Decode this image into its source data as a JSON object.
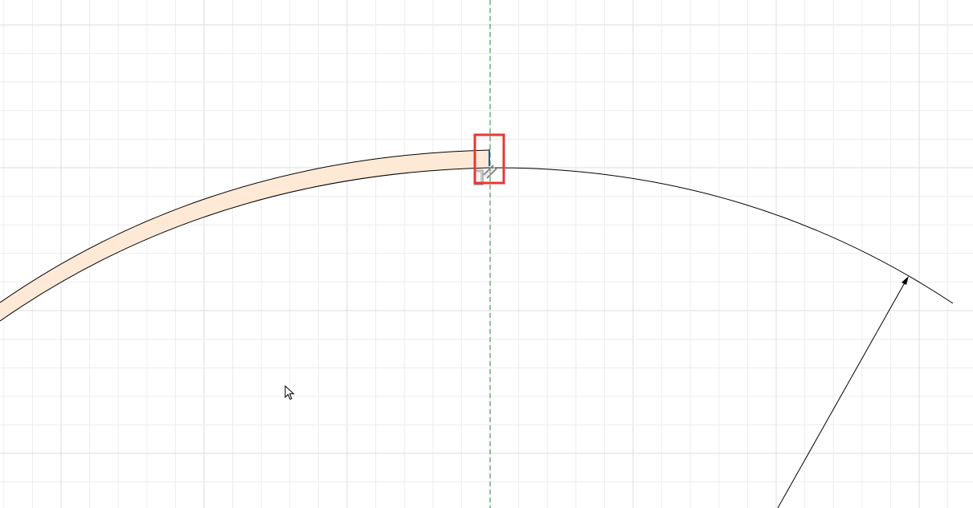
{
  "canvas": {
    "background": "#ffffff",
    "grid_minor_color": "#ececec",
    "grid_major_color": "#dcdcdc"
  },
  "construction_line": {
    "color": "#2e7d32",
    "style": "dashed"
  },
  "sketch": {
    "arc_color": "#000000",
    "profile_fill": "#fde9d5",
    "dimension_arrow_color": "#000000"
  },
  "highlight": {
    "color": "#e53935"
  },
  "constraint_glyphs": {
    "coincident_icon": "coincident-icon",
    "tangent_icon": "tangent-icon",
    "vertex_marker_color": "#1e5fb4"
  },
  "cursor": {
    "icon": "arrow-cursor-icon"
  }
}
